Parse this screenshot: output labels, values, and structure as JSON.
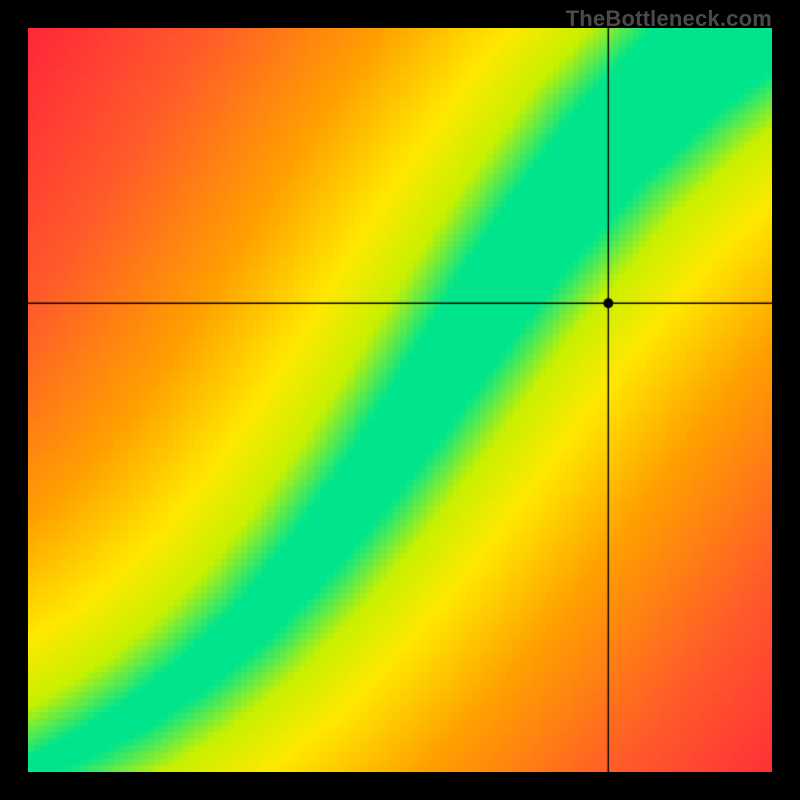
{
  "watermark": "TheBottleneck.com",
  "chart_data": {
    "type": "heatmap",
    "title": "",
    "xlabel": "",
    "ylabel": "",
    "xlim": [
      0,
      100
    ],
    "ylim": [
      0,
      100
    ],
    "grid": false,
    "legend": false,
    "ridge": {
      "description": "Optimal-balance ridge (green) from lower-left to upper-right; deviation transitions through yellow → orange → red.",
      "points": [
        {
          "x": 0,
          "y": 0
        },
        {
          "x": 8,
          "y": 4
        },
        {
          "x": 15,
          "y": 8
        },
        {
          "x": 22,
          "y": 13
        },
        {
          "x": 30,
          "y": 20
        },
        {
          "x": 38,
          "y": 29
        },
        {
          "x": 45,
          "y": 38
        },
        {
          "x": 52,
          "y": 48
        },
        {
          "x": 58,
          "y": 57
        },
        {
          "x": 64,
          "y": 66
        },
        {
          "x": 70,
          "y": 74
        },
        {
          "x": 78,
          "y": 84
        },
        {
          "x": 88,
          "y": 94
        },
        {
          "x": 100,
          "y": 104
        }
      ],
      "width_start": 1.5,
      "width_end": 14
    },
    "marker": {
      "x": 78,
      "y": 63
    },
    "crosshair": {
      "x": 78,
      "y": 63
    },
    "color_stops": [
      {
        "d": 0.0,
        "color": "#00E58C"
      },
      {
        "d": 0.1,
        "color": "#00E58C"
      },
      {
        "d": 0.18,
        "color": "#C8F000"
      },
      {
        "d": 0.28,
        "color": "#FFE800"
      },
      {
        "d": 0.45,
        "color": "#FFA000"
      },
      {
        "d": 0.7,
        "color": "#FF5A2A"
      },
      {
        "d": 1.0,
        "color": "#FF1E3C"
      }
    ]
  }
}
